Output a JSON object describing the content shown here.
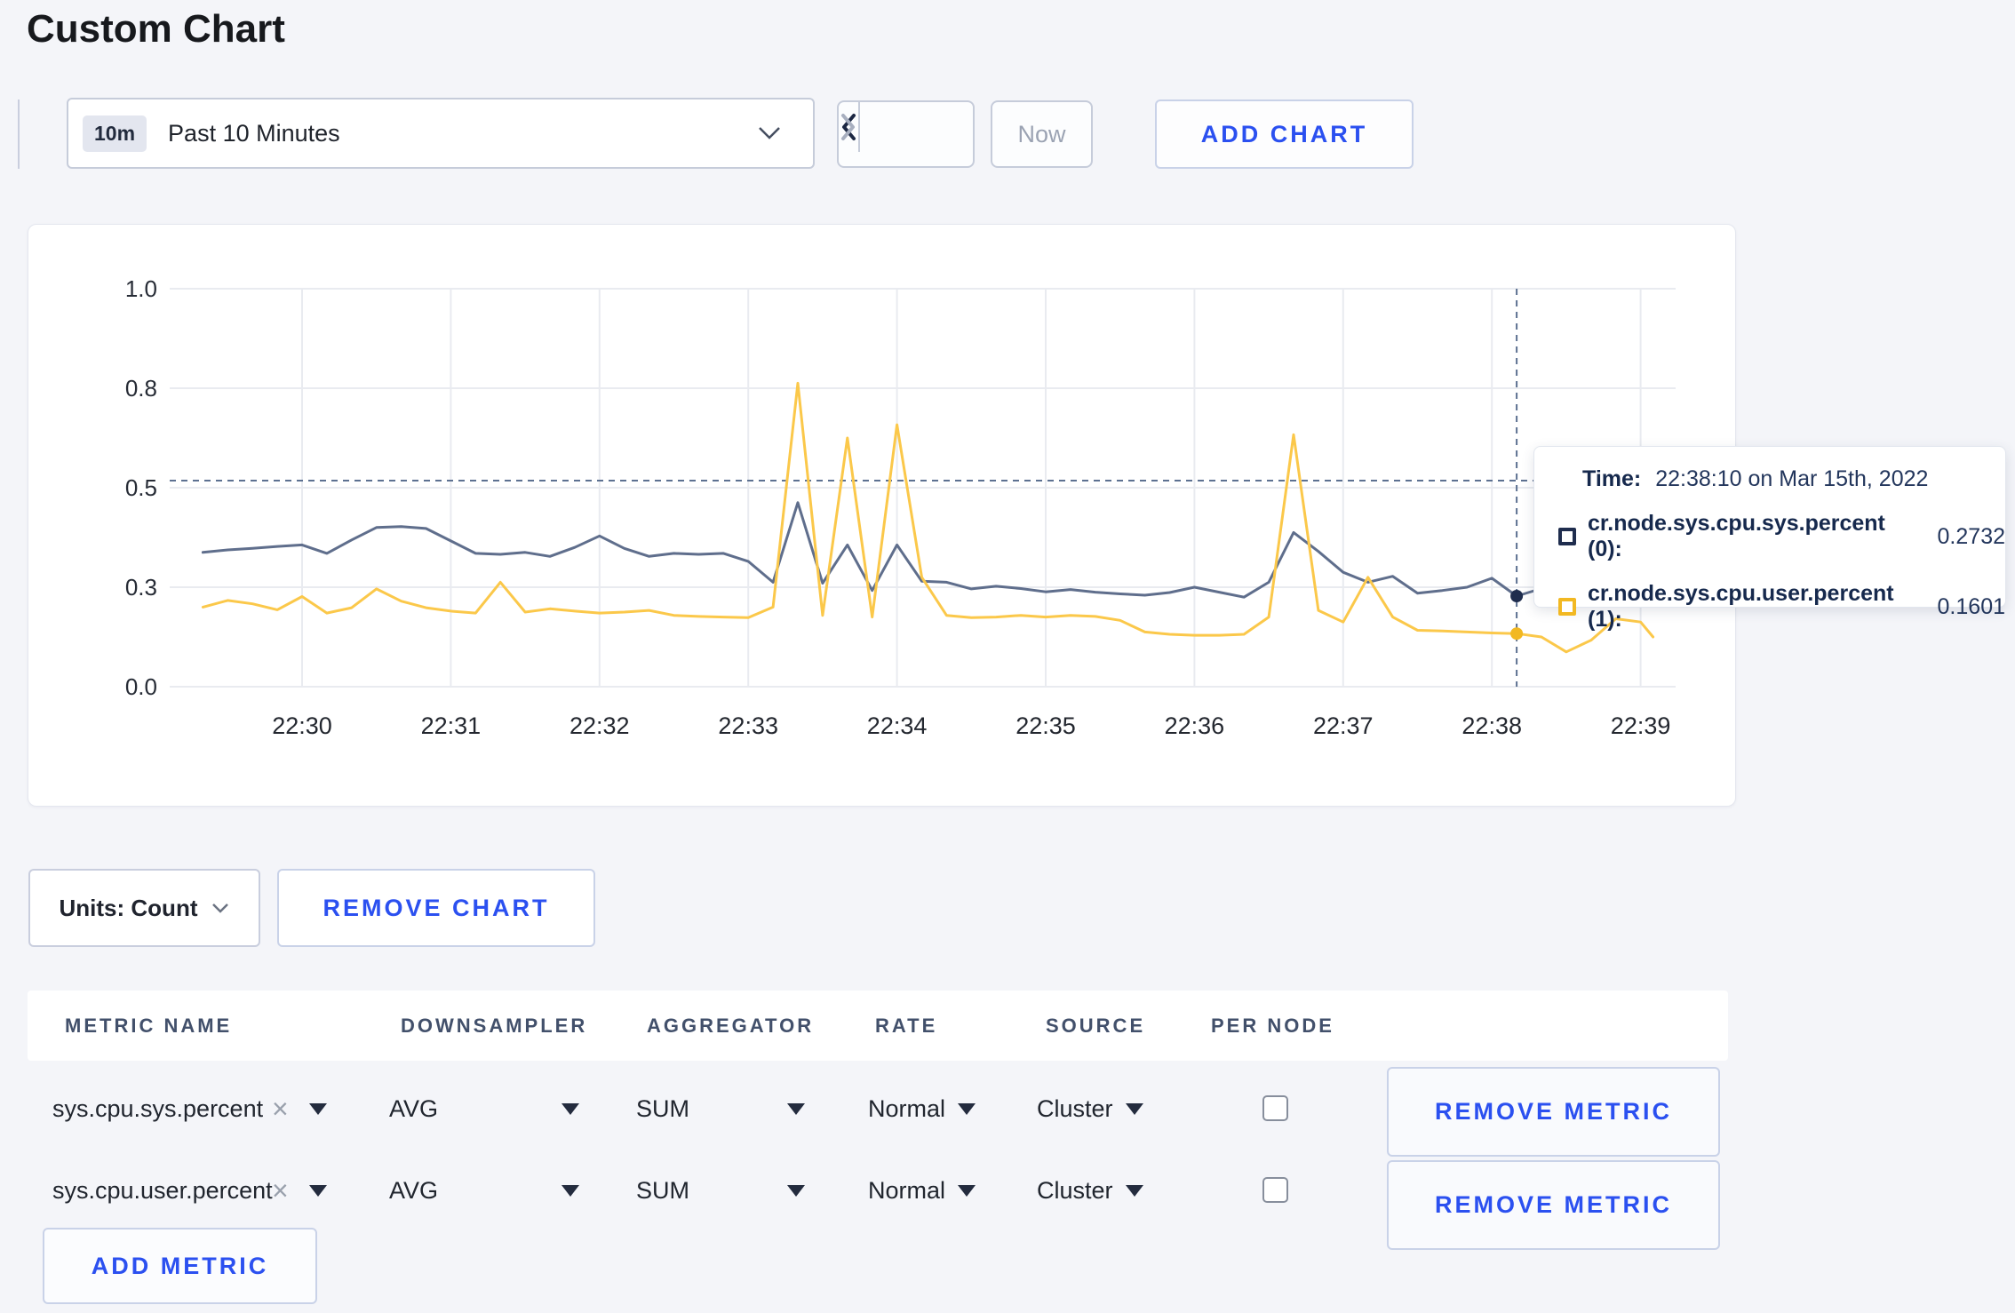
{
  "page": {
    "title": "Custom Chart",
    "background": "#f4f5f9",
    "accent_blue": "#2b50f0"
  },
  "toolbar": {
    "time_selector": {
      "badge": "10m",
      "value": "Past 10 Minutes"
    },
    "now_button": "Now",
    "add_chart_button": "ADD CHART"
  },
  "chart_tooltip": {
    "time_label": "Time:",
    "time_value": "22:38:10 on Mar 15th, 2022",
    "rows": [
      {
        "label": "cr.node.sys.cpu.sys.percent (0):",
        "value": "0.2732",
        "swatch_color": "#1f2d4e"
      },
      {
        "label": "cr.node.sys.cpu.user.percent (1):",
        "value": "0.1601",
        "swatch_color": "#f2b822"
      }
    ]
  },
  "chart_controls": {
    "units_button": "Units: Count",
    "remove_chart_button": "REMOVE CHART"
  },
  "metrics_table": {
    "headers": [
      "METRIC NAME",
      "DOWNSAMPLER",
      "AGGREGATOR",
      "RATE",
      "SOURCE",
      "PER NODE"
    ],
    "rows": [
      {
        "metric": "sys.cpu.sys.percent",
        "downsampler": "AVG",
        "aggregator": "SUM",
        "rate": "Normal",
        "source": "Cluster",
        "per_node_checked": false,
        "remove_button": "REMOVE METRIC"
      },
      {
        "metric": "sys.cpu.user.percent",
        "downsampler": "AVG",
        "aggregator": "SUM",
        "rate": "Normal",
        "source": "Cluster",
        "per_node_checked": false,
        "remove_button": "REMOVE METRIC"
      }
    ],
    "add_metric_button": "ADD METRIC"
  },
  "icons": {
    "time_selector": "chevron-down-icon",
    "prev": "chevron-left-icon",
    "next": "chevron-right-icon",
    "units": "chevron-down-icon",
    "metric_clear": "x-clear-icon",
    "select_caret": "triangle-down-icon",
    "tooltip_swatch": "series-color-square"
  },
  "chart_data": {
    "type": "line",
    "title": "",
    "xlabel": "",
    "ylabel": "",
    "ylim": [
      0.0,
      1.0
    ],
    "grid": true,
    "legend": "tooltip-only",
    "y_tick_values": [
      0.0,
      0.3,
      0.5,
      0.8,
      1.0
    ],
    "y_tick_labels": [
      "0.0",
      "0.3",
      "0.5",
      "0.8",
      "1.0"
    ],
    "x_tick_labels": [
      "22:30",
      "22:31",
      "22:32",
      "22:33",
      "22:34",
      "22:35",
      "22:36",
      "22:37",
      "22:38",
      "22:39"
    ],
    "x": [
      "22:29:20",
      "22:29:30",
      "22:29:40",
      "22:29:50",
      "22:30:00",
      "22:30:10",
      "22:30:20",
      "22:30:30",
      "22:30:40",
      "22:30:50",
      "22:31:00",
      "22:31:10",
      "22:31:20",
      "22:31:30",
      "22:31:40",
      "22:31:50",
      "22:32:00",
      "22:32:10",
      "22:32:20",
      "22:32:30",
      "22:32:40",
      "22:32:50",
      "22:33:00",
      "22:33:10",
      "22:33:20",
      "22:33:30",
      "22:33:40",
      "22:33:50",
      "22:34:00",
      "22:34:10",
      "22:34:20",
      "22:34:30",
      "22:34:40",
      "22:34:50",
      "22:35:00",
      "22:35:10",
      "22:35:20",
      "22:35:30",
      "22:35:40",
      "22:35:50",
      "22:36:00",
      "22:36:10",
      "22:36:20",
      "22:36:30",
      "22:36:40",
      "22:36:50",
      "22:37:00",
      "22:37:10",
      "22:37:20",
      "22:37:30",
      "22:37:40",
      "22:37:50",
      "22:38:00",
      "22:38:10",
      "22:38:20",
      "22:38:30",
      "22:38:40",
      "22:38:50",
      "22:39:00",
      "22:39:05"
    ],
    "series": [
      {
        "name": "cr.node.sys.cpu.sys.percent (0)",
        "color": "#5f6e8c",
        "values": [
          0.37,
          0.375,
          0.378,
          0.382,
          0.385,
          0.368,
          0.395,
          0.42,
          0.422,
          0.418,
          0.393,
          0.368,
          0.366,
          0.37,
          0.362,
          0.38,
          0.403,
          0.378,
          0.362,
          0.368,
          0.366,
          0.368,
          0.352,
          0.31,
          0.47,
          0.308,
          0.385,
          0.29,
          0.385,
          0.312,
          0.31,
          0.295,
          0.302,
          0.296,
          0.286,
          0.293,
          0.285,
          0.28,
          0.276,
          0.284,
          0.3,
          0.285,
          0.27,
          0.31,
          0.41,
          0.372,
          0.33,
          0.31,
          0.322,
          0.282,
          0.29,
          0.3,
          0.318,
          0.2732,
          0.296,
          0.31,
          0.33,
          0.3,
          0.302,
          0.3
        ]
      },
      {
        "name": "cr.node.sys.cpu.user.percent (1)",
        "color": "#fbc84a",
        "values": [
          0.24,
          0.26,
          0.25,
          0.232,
          0.272,
          0.222,
          0.238,
          0.295,
          0.258,
          0.238,
          0.228,
          0.222,
          0.31,
          0.225,
          0.235,
          0.228,
          0.222,
          0.225,
          0.23,
          0.215,
          0.212,
          0.21,
          0.208,
          0.24,
          0.81,
          0.215,
          0.65,
          0.21,
          0.69,
          0.32,
          0.215,
          0.208,
          0.21,
          0.215,
          0.21,
          0.215,
          0.212,
          0.2,
          0.165,
          0.158,
          0.155,
          0.155,
          0.158,
          0.21,
          0.66,
          0.23,
          0.195,
          0.32,
          0.21,
          0.17,
          0.168,
          0.165,
          0.162,
          0.1601,
          0.15,
          0.105,
          0.14,
          0.205,
          0.195,
          0.15
        ]
      }
    ],
    "crosshair": {
      "time": "22:38:10",
      "highlight": [
        {
          "series": 0,
          "value": 0.2732
        },
        {
          "series": 1,
          "value": 0.1601
        }
      ]
    }
  }
}
